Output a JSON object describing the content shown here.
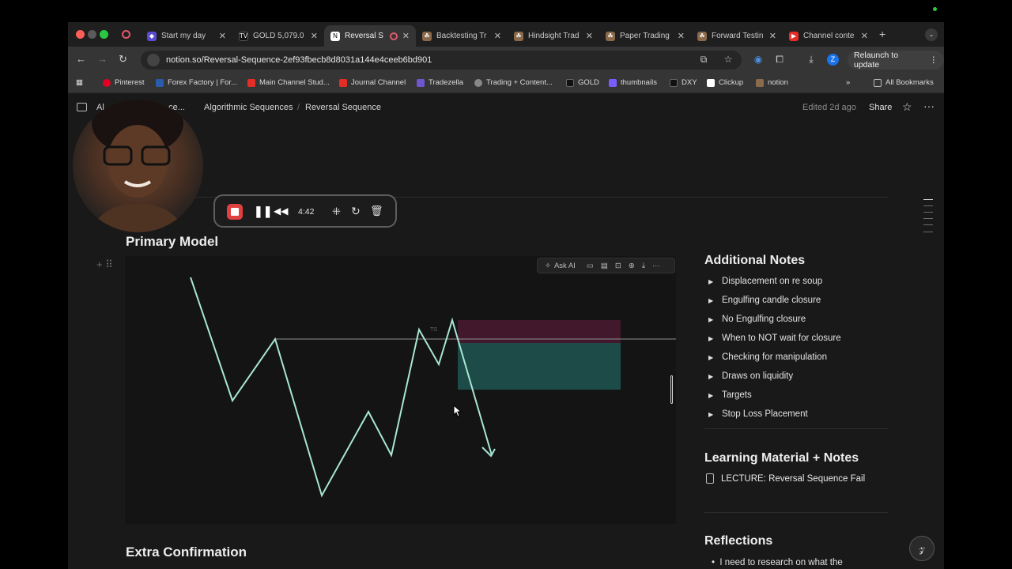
{
  "browser": {
    "tabs": [
      {
        "title": "Start my day",
        "active": false
      },
      {
        "title": "GOLD 5,079.0",
        "active": false
      },
      {
        "title": "Reversal S",
        "active": true
      },
      {
        "title": "Backtesting Tr",
        "active": false
      },
      {
        "title": "Hindsight Trad",
        "active": false
      },
      {
        "title": "Paper Trading",
        "active": false
      },
      {
        "title": "Forward Testin",
        "active": false
      },
      {
        "title": "Channel conte",
        "active": false
      }
    ],
    "new_tab_label": "+",
    "url": "notion.so/Reversal-Sequence-2ef93fbecb8d8031a144e4ceeb6bd901",
    "relaunch_label": "Relaunch to update",
    "profile_initial": "Z",
    "bookmarks": [
      "Pinterest",
      "Forex Factory | For...",
      "Main Channel Stud...",
      "Journal Channel",
      "Tradezella",
      "Trading + Content...",
      "GOLD",
      "thumbnails",
      "DXY",
      "Clickup",
      "notion"
    ],
    "all_bookmarks_label": "All Bookmarks"
  },
  "notion": {
    "breadcrumbs": [
      "Al...",
      "...ce...",
      "Algorithmic Sequences",
      "Reversal Sequence"
    ],
    "edited": "Edited 2d ago",
    "share_label": "Share",
    "primary_model_heading": "Primary Model",
    "extra_confirmation_heading": "Extra Confirmation",
    "image_toolbar": {
      "ask_ai_label": "Ask AI"
    },
    "chart_annotation": "TS",
    "additional_notes": {
      "heading": "Additional Notes",
      "items": [
        "Displacement on re soup",
        "Engulfing candle closure",
        "No Engulfing closure",
        "When to NOT wait for closure",
        "Checking for manipulation",
        "Draws on liquidity",
        "Targets",
        "Stop Loss Placement"
      ]
    },
    "learning_material": {
      "heading": "Learning Material + Notes",
      "item": "LECTURE: Reversal Sequence Fail"
    },
    "reflections": {
      "heading": "Reflections",
      "bullet": "I need to research on what the"
    }
  },
  "recorder": {
    "time": "4:42"
  },
  "colors": {
    "line": "#a8e6d4",
    "supply_zone": "#5a1a3a",
    "demand_zone": "#1f5a55",
    "page_bg": "#191919"
  }
}
